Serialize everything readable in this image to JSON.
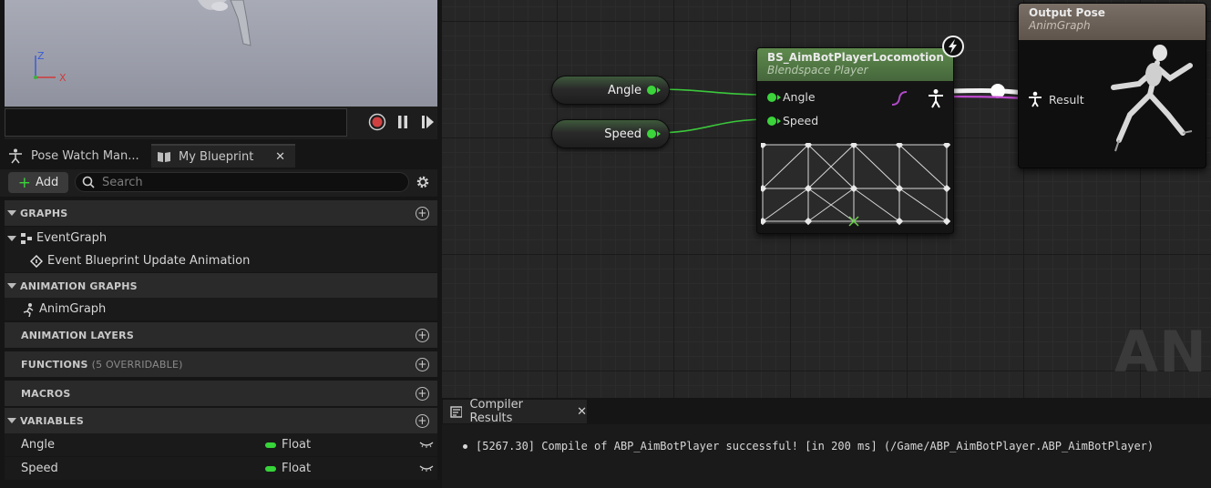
{
  "viewport": {
    "axis_z": "Z",
    "axis_x": "X"
  },
  "tabs": [
    {
      "label": "Pose Watch Man..."
    },
    {
      "label": "My Blueprint"
    }
  ],
  "toolbar": {
    "add_label": "Add",
    "search_placeholder": "Search"
  },
  "sections": {
    "graphs": "GRAPHS",
    "animation_graphs": "ANIMATION GRAPHS",
    "animation_layers": "ANIMATION LAYERS",
    "functions": "FUNCTIONS",
    "functions_sub": "(5 OVERRIDABLE)",
    "macros": "MACROS",
    "variables": "VARIABLES"
  },
  "graphs": {
    "event_graph": "EventGraph",
    "event_update": "Event Blueprint Update Animation"
  },
  "anim_graphs": {
    "anim_graph": "AnimGraph"
  },
  "variables": [
    {
      "name": "Angle",
      "type": "Float"
    },
    {
      "name": "Speed",
      "type": "Float"
    }
  ],
  "graph": {
    "watermark": "ANIM",
    "var_nodes": [
      {
        "label": "Angle"
      },
      {
        "label": "Speed"
      }
    ],
    "blendspace": {
      "title": "BS_AimBotPlayerLocomotion",
      "subtitle": "Blendspace Player",
      "pins": [
        "Angle",
        "Speed"
      ]
    },
    "output": {
      "title": "Output Pose",
      "subtitle": "AnimGraph",
      "pin": "Result"
    }
  },
  "compiler": {
    "tab_label": "Compiler Results",
    "message": "[5267.30] Compile of ABP_AimBotPlayer successful! [in 200 ms] (/Game/ABP_AimBotPlayer.ABP_AimBotPlayer)"
  },
  "colors": {
    "float_pin": "#37d43a",
    "pose_wire": "#c04ad0",
    "record_red": "#d04040"
  }
}
